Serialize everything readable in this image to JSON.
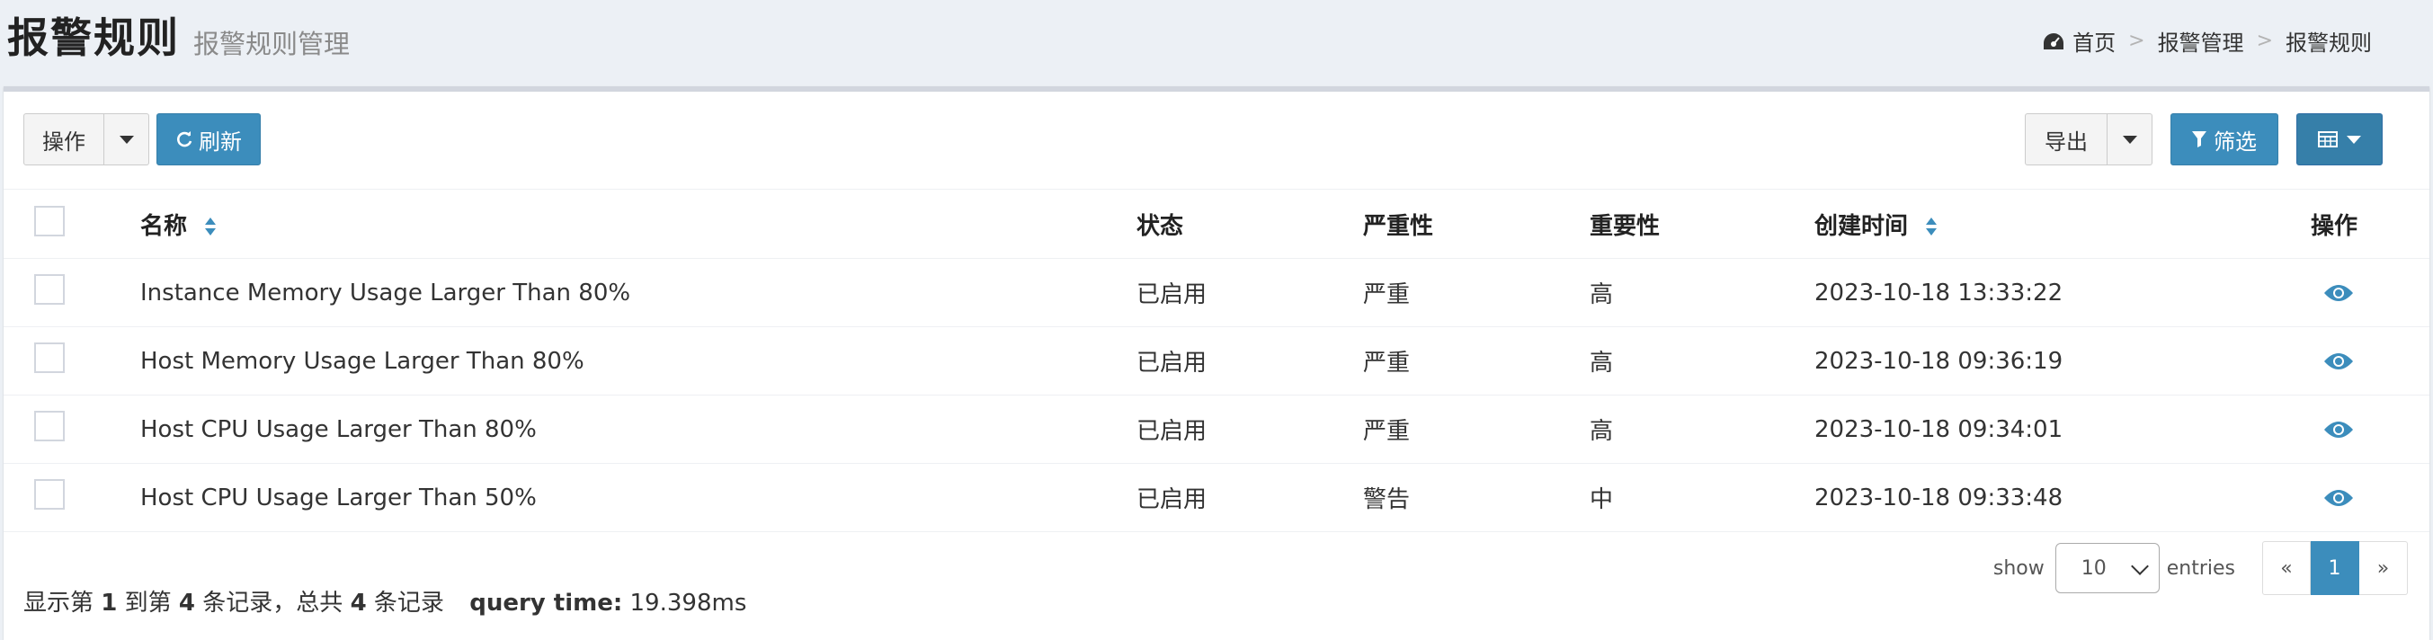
{
  "header": {
    "title": "报警规则",
    "subtitle": "报警规则管理",
    "breadcrumb": [
      "首页",
      "报警管理",
      "报警规则"
    ],
    "separator": ">"
  },
  "toolbar": {
    "actions_label": "操作",
    "refresh_label": "刷新",
    "export_label": "导出",
    "filter_label": "筛选"
  },
  "table": {
    "columns": [
      "名称",
      "状态",
      "严重性",
      "重要性",
      "创建时间",
      "操作"
    ],
    "rows": [
      {
        "name": "Instance Memory Usage Larger Than 80%",
        "status": "已启用",
        "severity": "严重",
        "importance": "高",
        "created": "2023-10-18 13:33:22"
      },
      {
        "name": "Host Memory Usage Larger Than 80%",
        "status": "已启用",
        "severity": "严重",
        "importance": "高",
        "created": "2023-10-18 09:36:19"
      },
      {
        "name": "Host CPU Usage Larger Than 80%",
        "status": "已启用",
        "severity": "严重",
        "importance": "高",
        "created": "2023-10-18 09:34:01"
      },
      {
        "name": "Host CPU Usage Larger Than 50%",
        "status": "已启用",
        "severity": "警告",
        "importance": "中",
        "created": "2023-10-18 09:33:48"
      }
    ]
  },
  "footer": {
    "summary_prefix": "显示第",
    "from": "1",
    "summary_to": "到第",
    "to": "4",
    "summary_records": "条记录，总共",
    "total": "4",
    "summary_suffix": "条记录",
    "query_label": "query time:",
    "query_value": "19.398ms",
    "show_label": "show",
    "page_size": "10",
    "entries_label": "entries",
    "prev": "«",
    "current_page": "1",
    "next": "»"
  },
  "colors": {
    "primary": "#3c8dbc",
    "background": "#ecf0f5"
  }
}
